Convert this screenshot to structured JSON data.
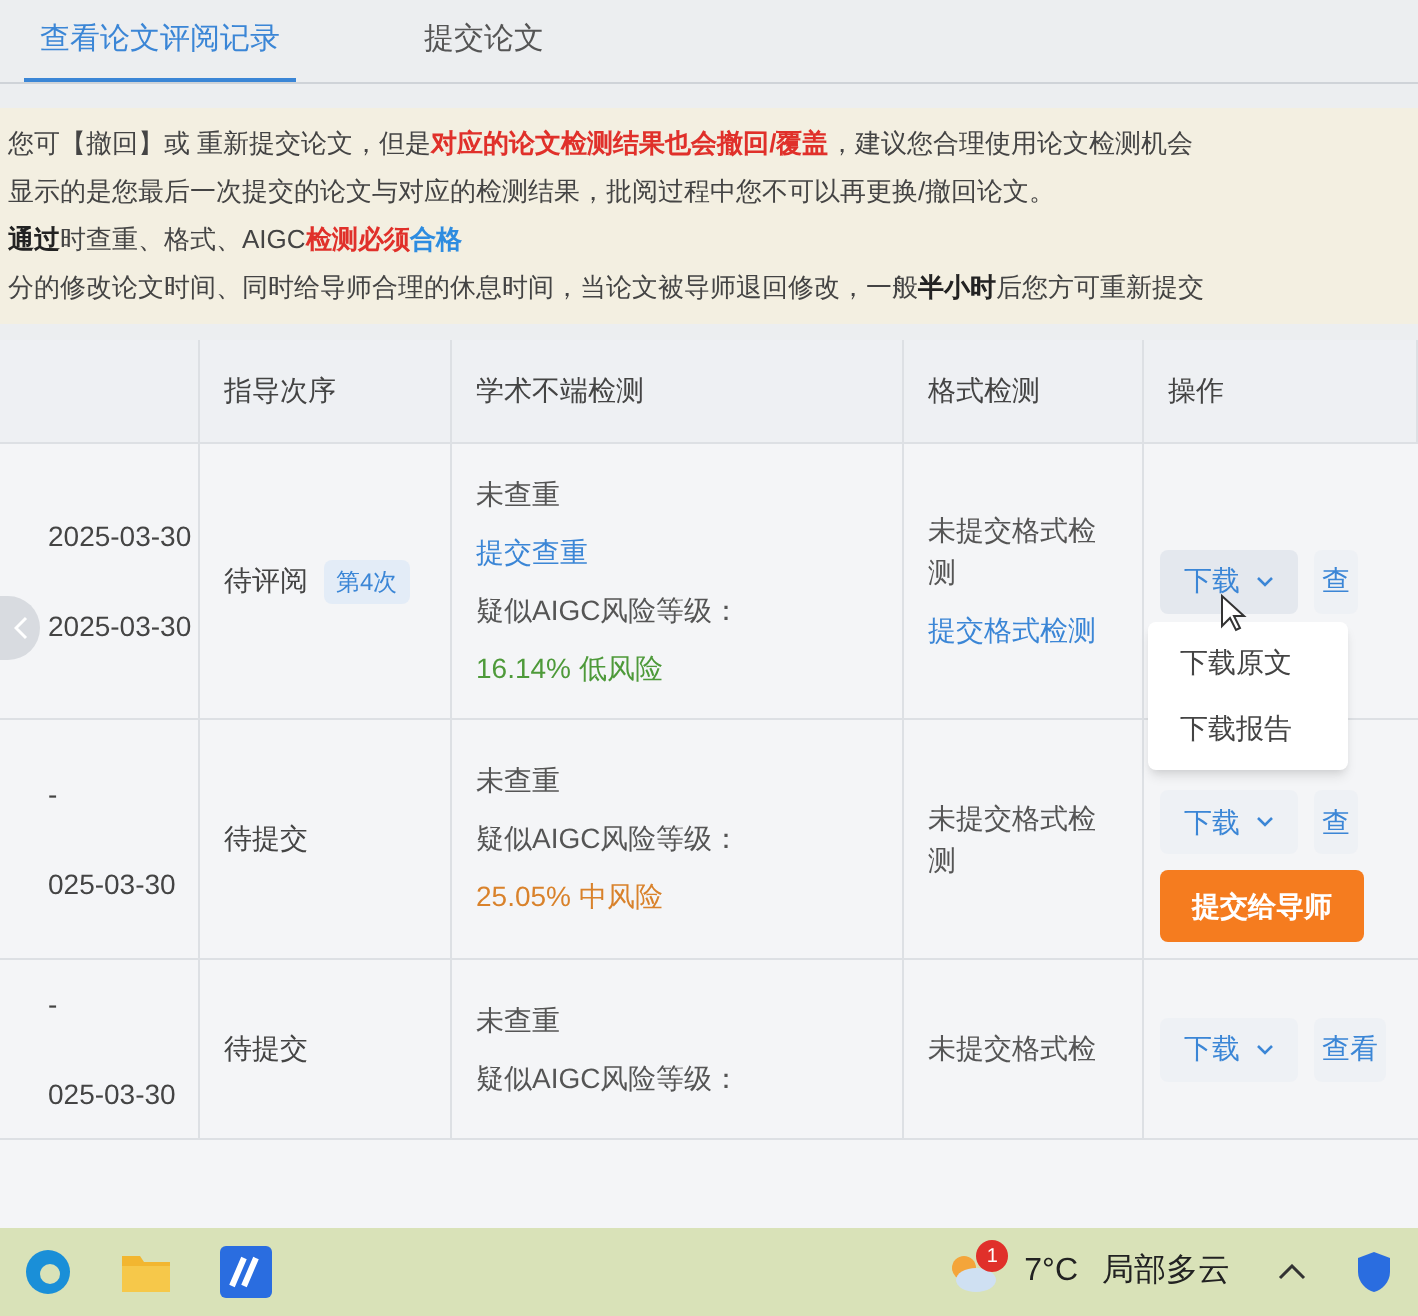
{
  "tabs": [
    {
      "label": "查看论文评阅记录",
      "selected": true
    },
    {
      "label": "提交论文",
      "selected": false
    }
  ],
  "notice": [
    [
      {
        "kind": "plain",
        "text": "您可【撤回】或 重新提交论文，但是"
      },
      {
        "kind": "red",
        "text": "对应的论文检测结果也会撤回/覆盖"
      },
      {
        "kind": "plain",
        "text": "，建议您合理使用论文检测机会"
      }
    ],
    [
      {
        "kind": "plain",
        "text": "显示的是您最后一次提交的论文与对应的检测结果，批阅过程中您不可以再更换/撤回论文。"
      }
    ],
    [
      {
        "kind": "bold",
        "text": "通过"
      },
      {
        "kind": "plain",
        "text": "时查重、格式、AIGC"
      },
      {
        "kind": "red",
        "text": "检测必须"
      },
      {
        "kind": "blue",
        "text": "合格"
      }
    ],
    [
      {
        "kind": "plain",
        "text": "分的修改论文时间、同时给导师合理的休息时间，当论文被导师退回修改，一般"
      },
      {
        "kind": "bold",
        "text": "半小时"
      },
      {
        "kind": "plain",
        "text": "后您方可重新提交"
      }
    ]
  ],
  "table": {
    "columns": [
      "指导次序",
      "学术不端检测",
      "格式检测",
      "操作"
    ],
    "rows": [
      {
        "dates": [
          "2025-03-30",
          "2025-03-30"
        ],
        "status": "待评阅",
        "badge": "第4次",
        "check": [
          {
            "kind": "text",
            "text": "未查重"
          },
          {
            "kind": "link",
            "text": "提交查重"
          },
          {
            "kind": "text",
            "text": "疑似AIGC风险等级："
          },
          {
            "kind": "risk",
            "text": "16.14% 低风险",
            "color": "#4e9a3a"
          }
        ],
        "format": [
          {
            "kind": "text",
            "text": "未提交格式检测"
          },
          {
            "kind": "link",
            "text": "提交格式检测"
          }
        ],
        "actions": [
          {
            "kind": "dropdown",
            "text": "下载",
            "expanded": true,
            "menu": [
              "下载原文",
              "下载报告"
            ]
          },
          {
            "kind": "secondary",
            "text": "查"
          }
        ]
      },
      {
        "dates": [
          "-",
          "025-03-30"
        ],
        "status": "待提交",
        "check": [
          {
            "kind": "text",
            "text": "未查重"
          },
          {
            "kind": "text",
            "text": "疑似AIGC风险等级："
          },
          {
            "kind": "risk",
            "text": "25.05% 中风险",
            "color": "#d9822b"
          }
        ],
        "format": [
          {
            "kind": "text",
            "text": "未提交格式检测"
          }
        ],
        "actions": [
          {
            "kind": "dropdown",
            "text": "下载",
            "expanded": false
          },
          {
            "kind": "secondary",
            "text": "查"
          },
          {
            "kind": "primary",
            "text": "提交给导师"
          }
        ]
      },
      {
        "dates": [
          "-",
          "025-03-30"
        ],
        "status": "待提交",
        "check": [
          {
            "kind": "text",
            "text": "未查重"
          },
          {
            "kind": "text",
            "text": "疑似AIGC风险等级："
          }
        ],
        "format": [
          {
            "kind": "text",
            "text": "未提交格式检"
          }
        ],
        "actions": [
          {
            "kind": "dropdown",
            "text": "下载",
            "expanded": false
          },
          {
            "kind": "secondary",
            "text": "查看"
          }
        ]
      }
    ]
  },
  "taskbar": {
    "weather": {
      "badge": "1",
      "temperature": "7°C",
      "condition": "局部多云"
    }
  }
}
